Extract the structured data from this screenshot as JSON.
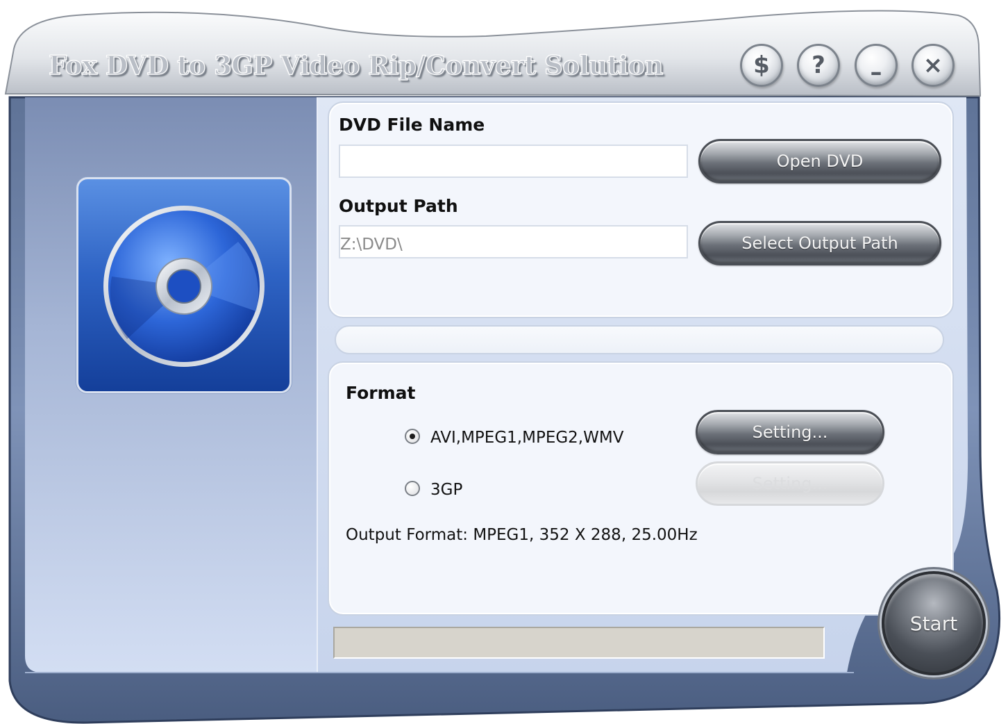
{
  "window": {
    "title": "Fox DVD to 3GP Video Rip/Convert Solution",
    "buttons": {
      "buy_icon": "dollar-icon",
      "buy_label": "$",
      "help_icon": "help-icon",
      "help_label": "?",
      "minimize_icon": "minimize-icon",
      "minimize_label": "–",
      "close_icon": "close-icon",
      "close_label": "×"
    }
  },
  "source": {
    "dvd_file_label": "DVD File Name",
    "dvd_file_value": "",
    "open_dvd_label": "Open DVD",
    "output_path_label": "Output Path",
    "output_path_value": "Z:\\DVD\\",
    "select_output_label": "Select Output Path"
  },
  "format": {
    "heading": "Format",
    "options": [
      {
        "label": "AVI,MPEG1,MPEG2,WMV",
        "selected": true,
        "setting_label": "Setting...",
        "setting_enabled": true
      },
      {
        "label": "3GP",
        "selected": false,
        "setting_label": "Setting...",
        "setting_enabled": false
      }
    ],
    "output_format_text": "Output Format: MPEG1, 352 X 288, 25.00Hz"
  },
  "progress": {
    "value": 0
  },
  "status": {
    "text": ""
  },
  "actions": {
    "start_label": "Start"
  },
  "colors": {
    "frame_dark": "#3b4f72",
    "panel_bg": "#f3f6fc",
    "left_panel_top": "#7d8fb6",
    "left_panel_bottom": "#cbd7ef",
    "logo_blue": "#2e63c4",
    "button_dark": "#4c5058"
  }
}
